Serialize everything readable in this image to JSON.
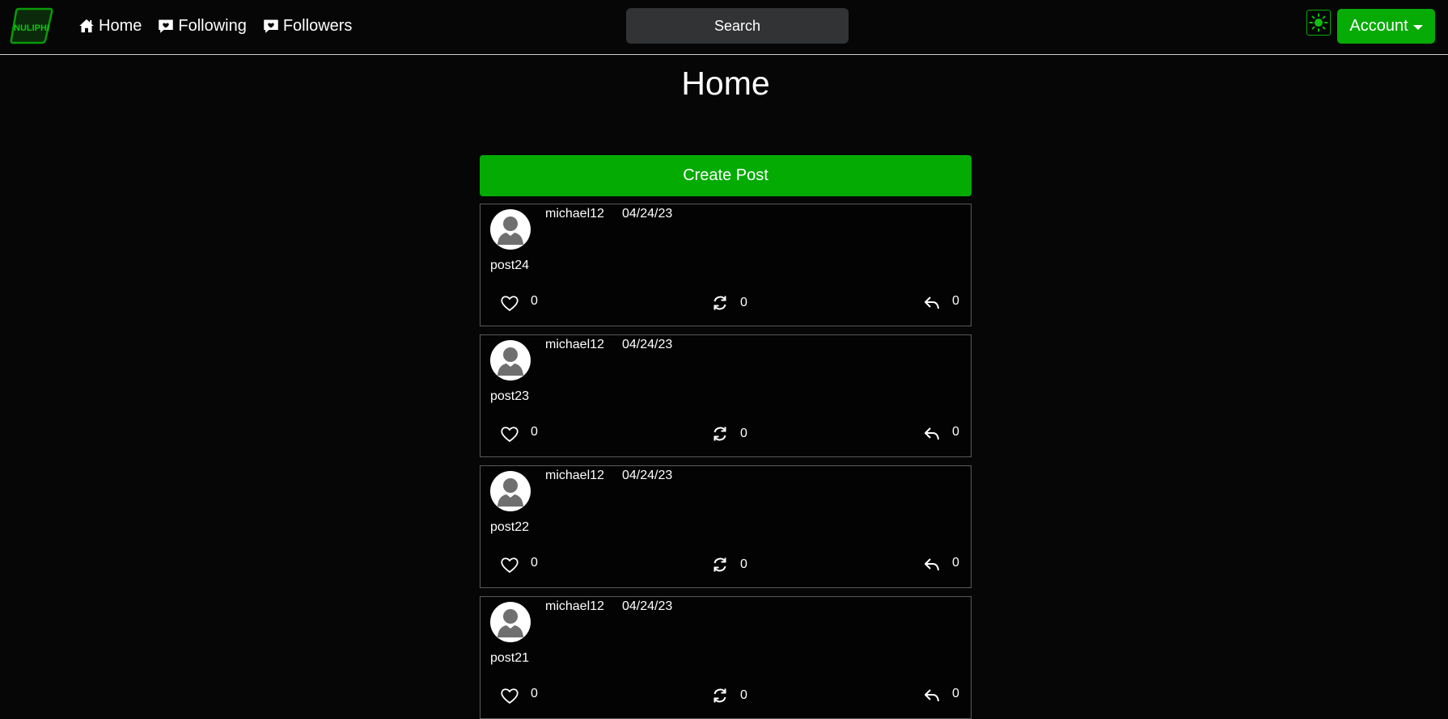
{
  "nav": {
    "logo_text": "NULIPHI",
    "links": [
      {
        "label": "Home",
        "icon": "house-icon"
      },
      {
        "label": "Following",
        "icon": "chat-heart-icon"
      },
      {
        "label": "Followers",
        "icon": "chat-heart-icon"
      }
    ],
    "search_label": "Search",
    "theme_icon": "sun-icon",
    "account_label": "Account"
  },
  "page": {
    "title": "Home",
    "create_post_label": "Create Post"
  },
  "colors": {
    "accent": "#06ab06",
    "background": "#060606",
    "search_bg": "#313335"
  },
  "posts": [
    {
      "user": "michael12",
      "date": "04/24/23",
      "body": "post24",
      "likes": "0",
      "reposts": "0",
      "replies": "0"
    },
    {
      "user": "michael12",
      "date": "04/24/23",
      "body": "post23",
      "likes": "0",
      "reposts": "0",
      "replies": "0"
    },
    {
      "user": "michael12",
      "date": "04/24/23",
      "body": "post22",
      "likes": "0",
      "reposts": "0",
      "replies": "0"
    },
    {
      "user": "michael12",
      "date": "04/24/23",
      "body": "post21",
      "likes": "0",
      "reposts": "0",
      "replies": "0"
    }
  ]
}
